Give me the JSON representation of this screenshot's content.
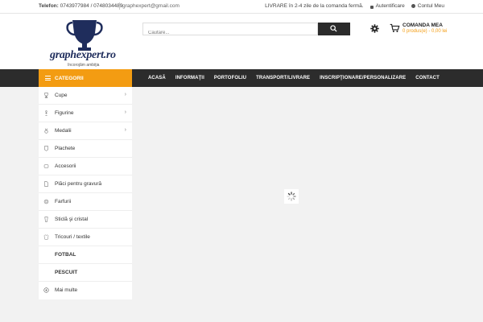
{
  "topbar": {
    "phone_label": "Telefon:",
    "phone_numbers": "0743977984 / 0748034489",
    "email": "graphexpert@gmail.com",
    "delivery": "LIVRARE în 2-4 zile de la comanda fermă.",
    "login": "Autentificare",
    "account": "Contul Meu"
  },
  "logo": {
    "name": "graphexpert.ro",
    "tagline": "încorojăm ambiţia"
  },
  "search": {
    "placeholder": "Căutare..."
  },
  "cart": {
    "title": "COMANDA MEA",
    "summary": "0 produs(e) - 0,00 lei"
  },
  "categories": {
    "title": "CATEGORII",
    "items": [
      {
        "label": "Cupe",
        "icon": "trophy-icon",
        "arrow": "›"
      },
      {
        "label": "Figurine",
        "icon": "figurine-icon",
        "arrow": "›"
      },
      {
        "label": "Medalii",
        "icon": "medal-icon",
        "arrow": "›"
      },
      {
        "label": "Plachete",
        "icon": "plaque-icon",
        "arrow": ""
      },
      {
        "label": "Accesorii",
        "icon": "accessory-icon",
        "arrow": ""
      },
      {
        "label": "Plăci pentru gravură",
        "icon": "plate-icon",
        "arrow": ""
      },
      {
        "label": "Farfurii",
        "icon": "dish-icon",
        "arrow": ""
      },
      {
        "label": "Sticlă şi cristal",
        "icon": "glass-icon",
        "arrow": ""
      },
      {
        "label": "Tricouri / textile",
        "icon": "tshirt-icon",
        "arrow": ""
      },
      {
        "label": "FOTBAL",
        "icon": "",
        "arrow": ""
      },
      {
        "label": "PESCUIT",
        "icon": "",
        "arrow": ""
      },
      {
        "label": "Mai multe",
        "icon": "plus-circle-icon",
        "arrow": ""
      }
    ]
  },
  "nav": {
    "items": [
      "ACASĂ",
      "INFORMAŢII",
      "PORTOFOLIU",
      "TRANSPORT/LIVRARE",
      "INSCRIPŢIONARE/PERSONALIZARE",
      "CONTACT"
    ]
  },
  "colors": {
    "accent": "#f39c12",
    "nav_bg": "#2c2c2c",
    "logo_blue": "#1f2d5c"
  }
}
